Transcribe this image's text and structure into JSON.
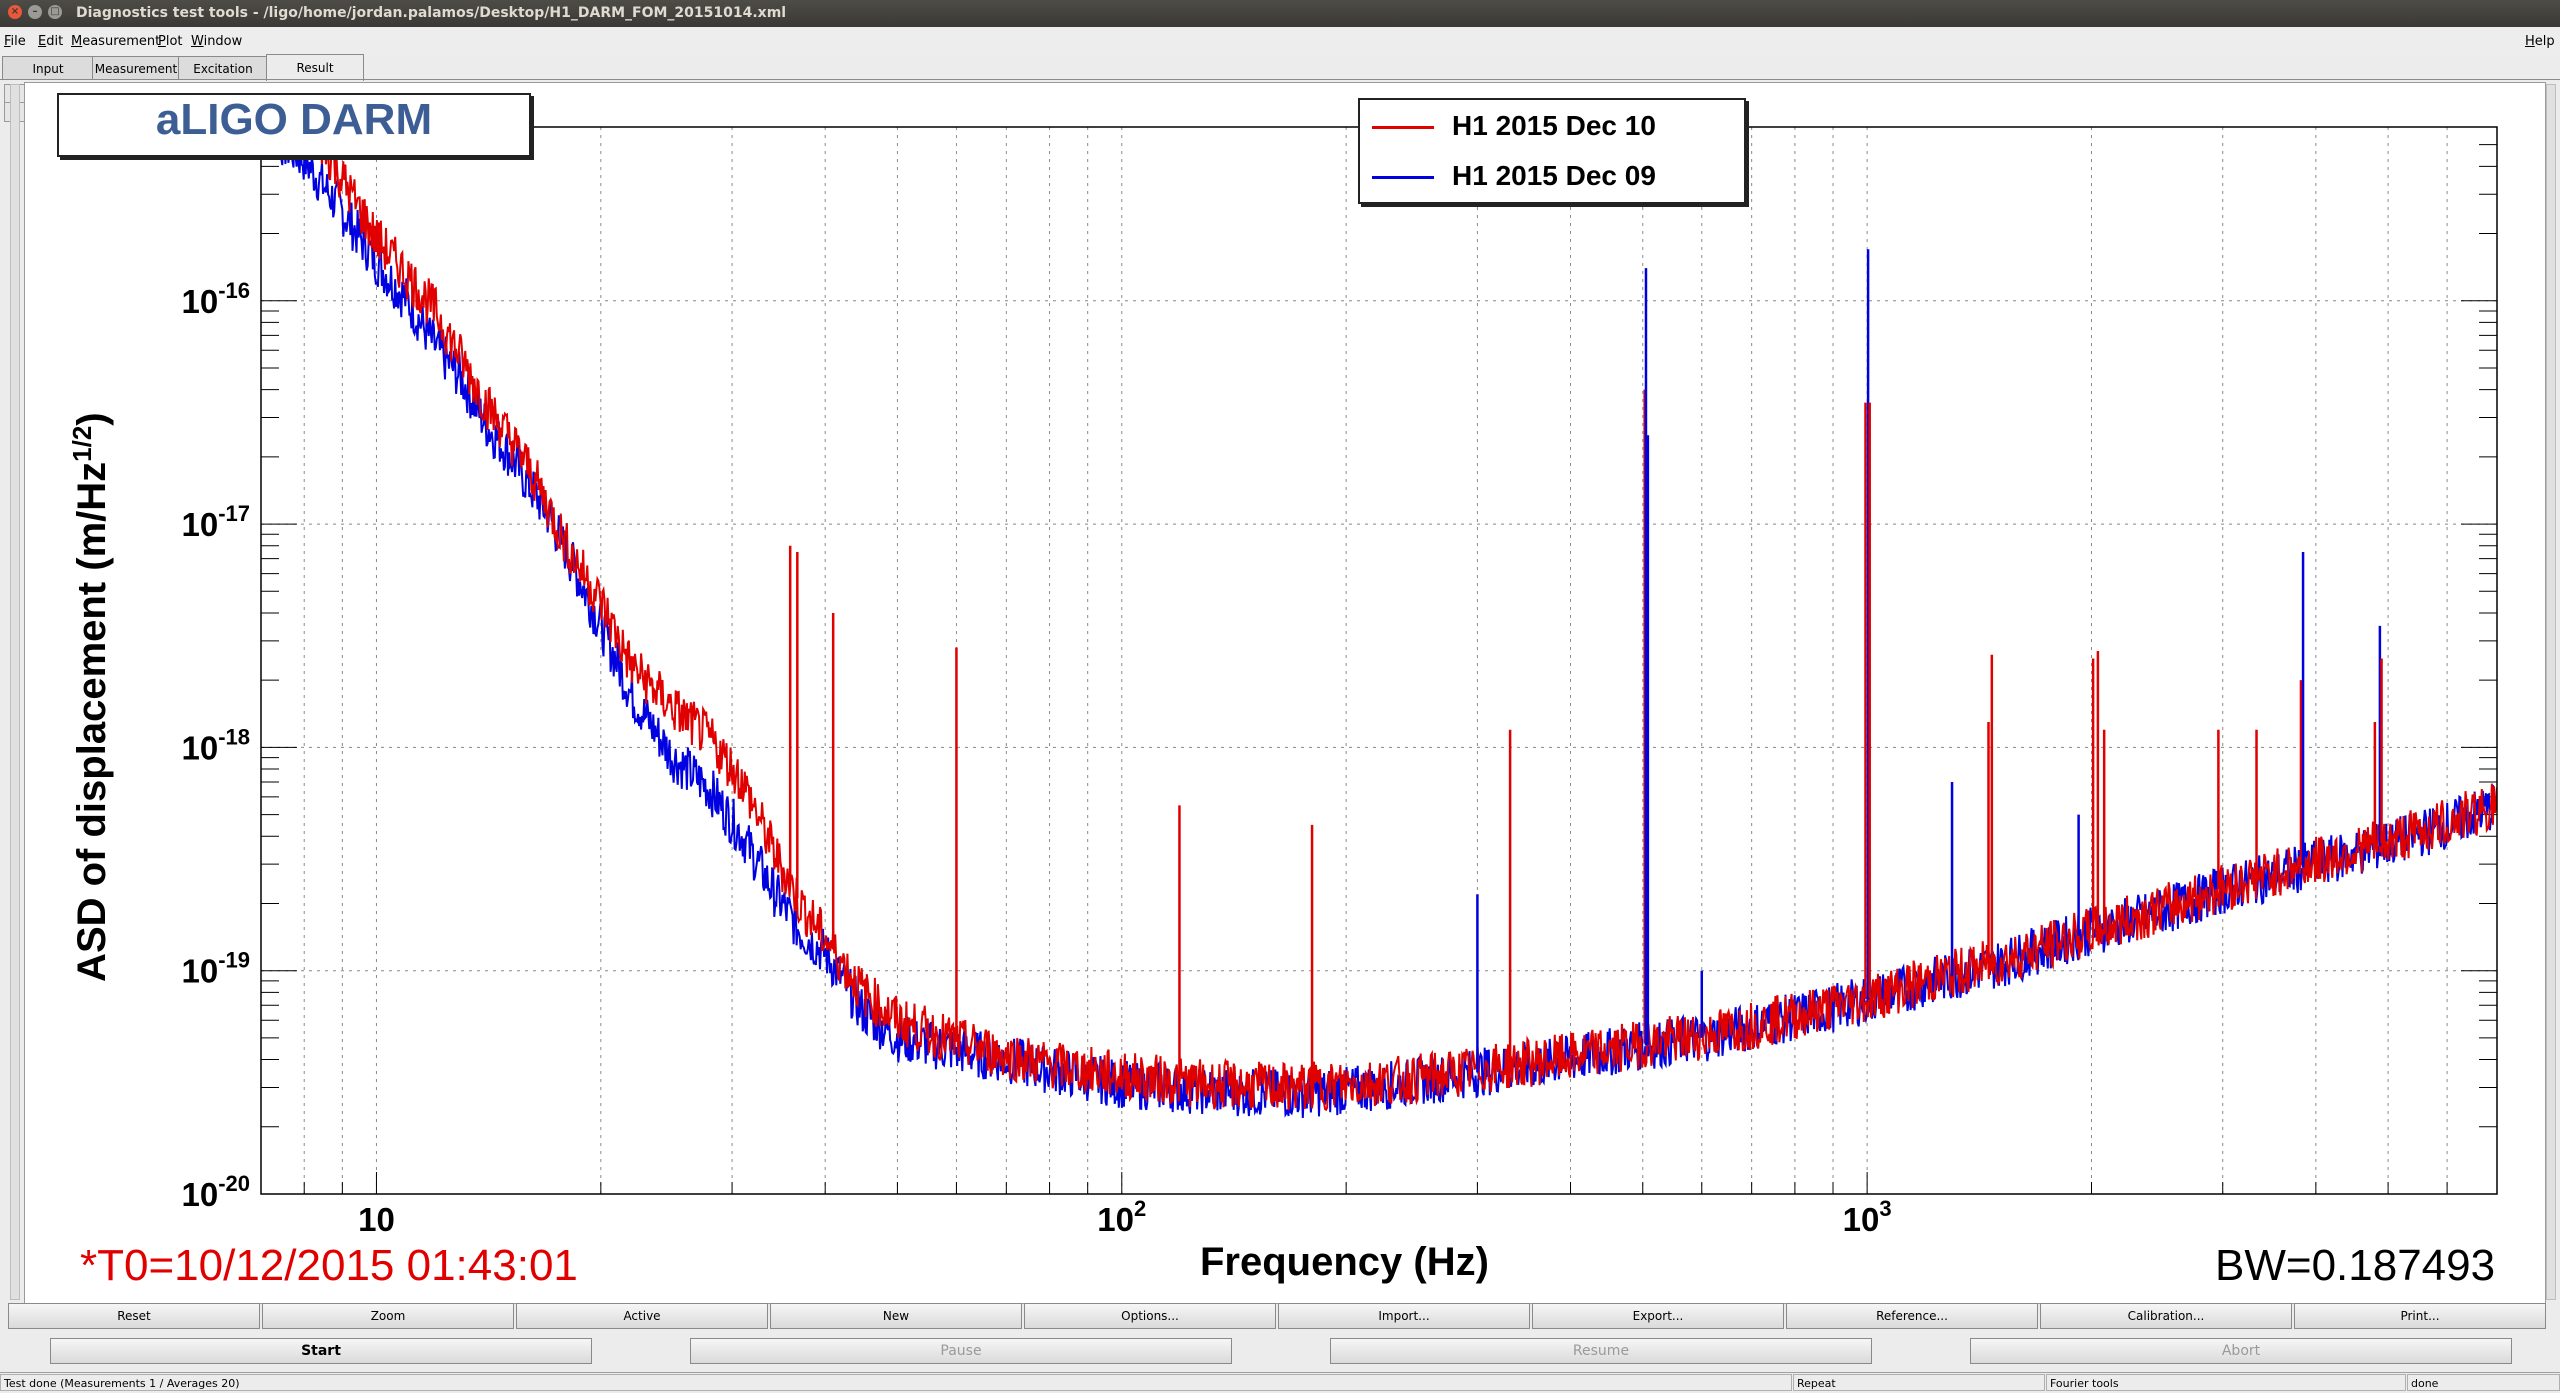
{
  "window": {
    "title": "Diagnostics test tools - /ligo/home/jordan.palamos/Desktop/H1_DARM_FOM_20151014.xml",
    "close_glyph": "×",
    "min_glyph": "–",
    "max_glyph": "□"
  },
  "menu": [
    {
      "key": "F",
      "rest": "ile"
    },
    {
      "key": "E",
      "rest": "dit"
    },
    {
      "key": "M",
      "rest": "easurement"
    },
    {
      "key": "P",
      "rest": "lot"
    },
    {
      "key": "W",
      "rest": "indow"
    }
  ],
  "help": {
    "key": "H",
    "rest": "elp"
  },
  "tabs": [
    "Input",
    "Measurement",
    "Excitation",
    "Result"
  ],
  "active_tab": "Result",
  "scroll_glyphs": {
    "right": "▸",
    "left": "◂"
  },
  "plot": {
    "title": "aLIGO DARM",
    "t0": "*T0=10/12/2015 01:43:01",
    "bw": "BW=0.187493",
    "colors": {
      "title": "#3c5e95",
      "t0": "#e00000"
    }
  },
  "chart_data": {
    "type": "line",
    "xlabel": "Frequency (Hz)",
    "ylabel": "ASD of displacement (m/Hz^(1/2))",
    "x_scale": "log",
    "y_scale": "log",
    "xlim": [
      7,
      7000
    ],
    "ylim": [
      1e-20,
      6e-16
    ],
    "grid": true,
    "legend_position": "top-center",
    "x_ticks": [
      {
        "value": 10,
        "base": "10",
        "exp": ""
      },
      {
        "value": 100,
        "base": "10",
        "exp": "2"
      },
      {
        "value": 1000,
        "base": "10",
        "exp": "3"
      }
    ],
    "y_ticks": [
      {
        "value": 1e-16,
        "base": "10",
        "exp": "-16"
      },
      {
        "value": 1e-17,
        "base": "10",
        "exp": "-17"
      },
      {
        "value": 1e-18,
        "base": "10",
        "exp": "-18"
      },
      {
        "value": 1e-19,
        "base": "10",
        "exp": "-19"
      },
      {
        "value": 1e-20,
        "base": "10",
        "exp": "-20"
      }
    ],
    "series": [
      {
        "name": "H1 2015 Dec 09",
        "color": "#0000e0",
        "x": [
          7,
          8,
          9,
          10,
          11,
          12,
          13,
          14,
          15,
          16,
          17,
          18,
          20,
          22,
          25,
          28,
          31,
          34,
          37,
          40,
          45,
          50,
          60,
          70,
          80,
          100,
          130,
          170,
          200,
          250,
          300,
          400,
          500,
          600,
          700,
          800,
          1000,
          1200,
          1500,
          2000,
          2500,
          3000,
          4000,
          5000,
          6000,
          7000
        ],
        "y": [
          6e-16,
          4.3e-16,
          2.5e-16,
          1.5e-16,
          1e-16,
          6.2e-17,
          4.5e-17,
          2.8e-17,
          2.1e-17,
          1.5e-17,
          1.1e-17,
          7.5e-18,
          3.5e-18,
          1.7e-18,
          9e-19,
          6.5e-19,
          4e-19,
          2.3e-19,
          1.5e-19,
          1.2e-19,
          6.5e-20,
          5e-20,
          4.4e-20,
          4e-20,
          3.6e-20,
          3.1e-20,
          2.9e-20,
          2.8e-20,
          2.9e-20,
          3.2e-20,
          3.5e-20,
          4e-20,
          4.6e-20,
          5e-20,
          5.6e-20,
          6.2e-20,
          7.4e-20,
          8.8e-20,
          1.07e-19,
          1.5e-19,
          1.85e-19,
          2.3e-19,
          3e-19,
          3.7e-19,
          4.5e-19,
          5.5e-19
        ]
      },
      {
        "name": "H1 2015 Dec 10",
        "color": "#e00000",
        "x": [
          7,
          8,
          9,
          10,
          11,
          12,
          13,
          14,
          15,
          16,
          17,
          18,
          20,
          22,
          25,
          28,
          31,
          34,
          37,
          40,
          45,
          50,
          60,
          70,
          80,
          100,
          130,
          170,
          200,
          250,
          300,
          400,
          500,
          600,
          700,
          800,
          1000,
          1200,
          1500,
          2000,
          2500,
          3000,
          4000,
          5000,
          6000,
          7000
        ],
        "y": [
          1e-15,
          7e-16,
          3.5e-16,
          1.9e-16,
          1.3e-16,
          9e-17,
          5.5e-17,
          3.5e-17,
          2.5e-17,
          1.8e-17,
          1.2e-17,
          8e-18,
          4.5e-18,
          2.3e-18,
          1.5e-18,
          1.1e-18,
          7e-19,
          3.5e-19,
          2e-19,
          1.4e-19,
          8e-20,
          6e-20,
          4.8e-20,
          4.2e-20,
          3.8e-20,
          3.4e-20,
          3.1e-20,
          3e-20,
          3.1e-20,
          3.3e-20,
          3.6e-20,
          4.1e-20,
          4.7e-20,
          5.1e-20,
          5.7e-20,
          6.3e-20,
          7.5e-20,
          9e-20,
          1.1e-19,
          1.5e-19,
          1.9e-19,
          2.35e-19,
          3.1e-19,
          3.8e-19,
          4.6e-19,
          5.6e-19
        ]
      }
    ],
    "lines": [
      {
        "f": 35.9,
        "amp": 8e-18,
        "series": "H1 2015 Dec 10"
      },
      {
        "f": 36.7,
        "amp": 7.5e-18,
        "series": "H1 2015 Dec 10"
      },
      {
        "f": 41,
        "amp": 4e-18,
        "series": "H1 2015 Dec 10"
      },
      {
        "f": 60,
        "amp": 2.8e-18,
        "series": "H1 2015 Dec 10"
      },
      {
        "f": 119.5,
        "amp": 5.5e-19,
        "series": "H1 2015 Dec 10"
      },
      {
        "f": 180,
        "amp": 4.5e-19,
        "series": "H1 2015 Dec 10"
      },
      {
        "f": 300,
        "amp": 2.2e-19,
        "series": "H1 2015 Dec 09"
      },
      {
        "f": 331.9,
        "amp": 1.2e-18,
        "series": "H1 2015 Dec 10"
      },
      {
        "f": 503,
        "amp": 4e-17,
        "series": "H1 2015 Dec 10"
      },
      {
        "f": 505,
        "amp": 1.4e-16,
        "series": "H1 2015 Dec 09"
      },
      {
        "f": 508,
        "amp": 2.5e-17,
        "series": "H1 2015 Dec 09"
      },
      {
        "f": 600,
        "amp": 1e-19,
        "series": "H1 2015 Dec 09"
      },
      {
        "f": 995,
        "amp": 3.5e-17,
        "series": "H1 2015 Dec 10"
      },
      {
        "f": 1003,
        "amp": 1.7e-16,
        "series": "H1 2015 Dec 09"
      },
      {
        "f": 1008,
        "amp": 3.5e-17,
        "series": "H1 2015 Dec 10"
      },
      {
        "f": 1300,
        "amp": 7e-19,
        "series": "H1 2015 Dec 09"
      },
      {
        "f": 1455,
        "amp": 1.3e-18,
        "series": "H1 2015 Dec 10"
      },
      {
        "f": 1470,
        "amp": 2.6e-18,
        "series": "H1 2015 Dec 10"
      },
      {
        "f": 1922,
        "amp": 5e-19,
        "series": "H1 2015 Dec 09"
      },
      {
        "f": 2010,
        "amp": 2.5e-18,
        "series": "H1 2015 Dec 10"
      },
      {
        "f": 2040,
        "amp": 2.7e-18,
        "series": "H1 2015 Dec 10"
      },
      {
        "f": 2080,
        "amp": 1.2e-18,
        "series": "H1 2015 Dec 10"
      },
      {
        "f": 2960,
        "amp": 1.2e-18,
        "series": "H1 2015 Dec 10"
      },
      {
        "f": 3330,
        "amp": 1.2e-18,
        "series": "H1 2015 Dec 10"
      },
      {
        "f": 3820,
        "amp": 2e-18,
        "series": "H1 2015 Dec 10"
      },
      {
        "f": 3845,
        "amp": 7.5e-18,
        "series": "H1 2015 Dec 09"
      },
      {
        "f": 4800,
        "amp": 1.3e-18,
        "series": "H1 2015 Dec 10"
      },
      {
        "f": 4875,
        "amp": 3.5e-18,
        "series": "H1 2015 Dec 09"
      },
      {
        "f": 4900,
        "amp": 2.5e-18,
        "series": "H1 2015 Dec 10"
      }
    ]
  },
  "buttons_row1": [
    "Reset",
    "Zoom",
    "Active",
    "New",
    "Options...",
    "Import...",
    "Export...",
    "Reference...",
    "Calibration...",
    "Print..."
  ],
  "buttons_row2": [
    "Start",
    "Pause",
    "Resume",
    "Abort"
  ],
  "status": [
    "Test done (Measurements 1 / Averages 20)",
    "Repeat",
    "Fourier tools",
    "done"
  ]
}
